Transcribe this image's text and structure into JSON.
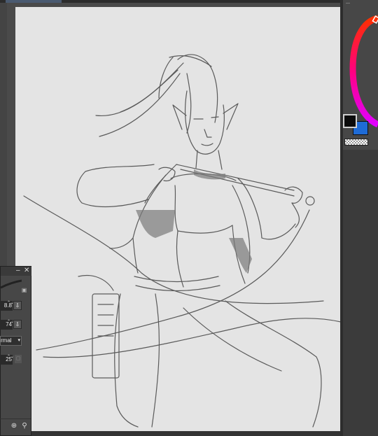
{
  "tool_panel": {
    "minimize_label": "–",
    "close_label": "✕",
    "lock_icon": "lock-icon",
    "fields": [
      {
        "value": "8.8"
      },
      {
        "value": "74"
      }
    ],
    "blend_mode": "rmal",
    "last_field": "25",
    "bottom_icons": [
      "download-icon",
      "wrench-icon"
    ]
  },
  "color": {
    "foreground": "#0b0b0b",
    "background": "#1e6bd6",
    "ring_colors": [
      "#ff2200",
      "#ff00aa",
      "#ff00ff"
    ]
  }
}
